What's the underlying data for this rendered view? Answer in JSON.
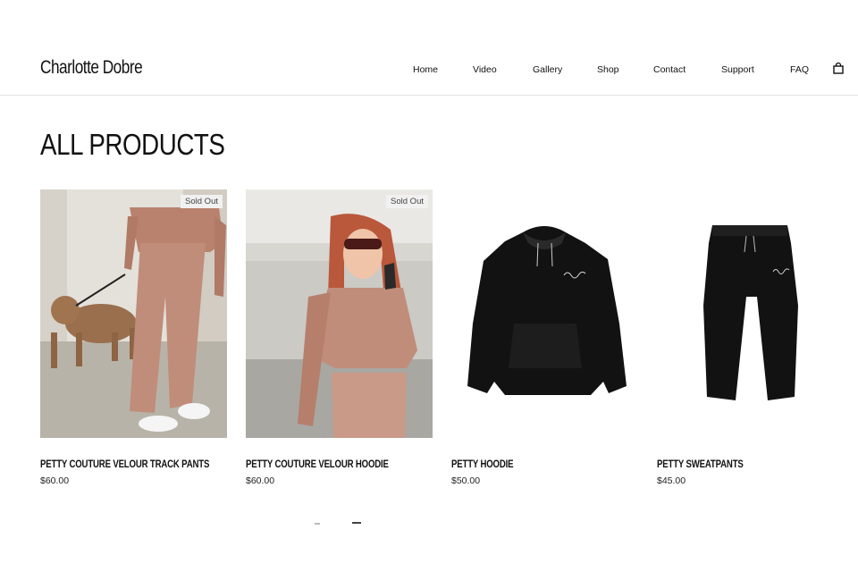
{
  "header": {
    "brand": "Charlotte Dobre",
    "nav": [
      "Home",
      "Video",
      "Gallery",
      "Shop",
      "Contact",
      "Support",
      "FAQ"
    ],
    "cart_icon": "shopping-bag-icon"
  },
  "main": {
    "title": "ALL PRODUCTS",
    "products": [
      {
        "name": "PETTY COUTURE VELOUR TRACK PANTS",
        "price": "$60.00",
        "badge": "Sold Out"
      },
      {
        "name": "PETTY COUTURE VELOUR HOODIE",
        "price": "$60.00",
        "badge": "Sold Out"
      },
      {
        "name": "PETTY HOODIE",
        "price": "$50.00",
        "badge": ""
      },
      {
        "name": "PETTY SWEATPANTS",
        "price": "$45.00",
        "badge": ""
      }
    ]
  },
  "colors": {
    "velour": "#c08d7b",
    "garment": "#111111",
    "text": "#111111"
  }
}
